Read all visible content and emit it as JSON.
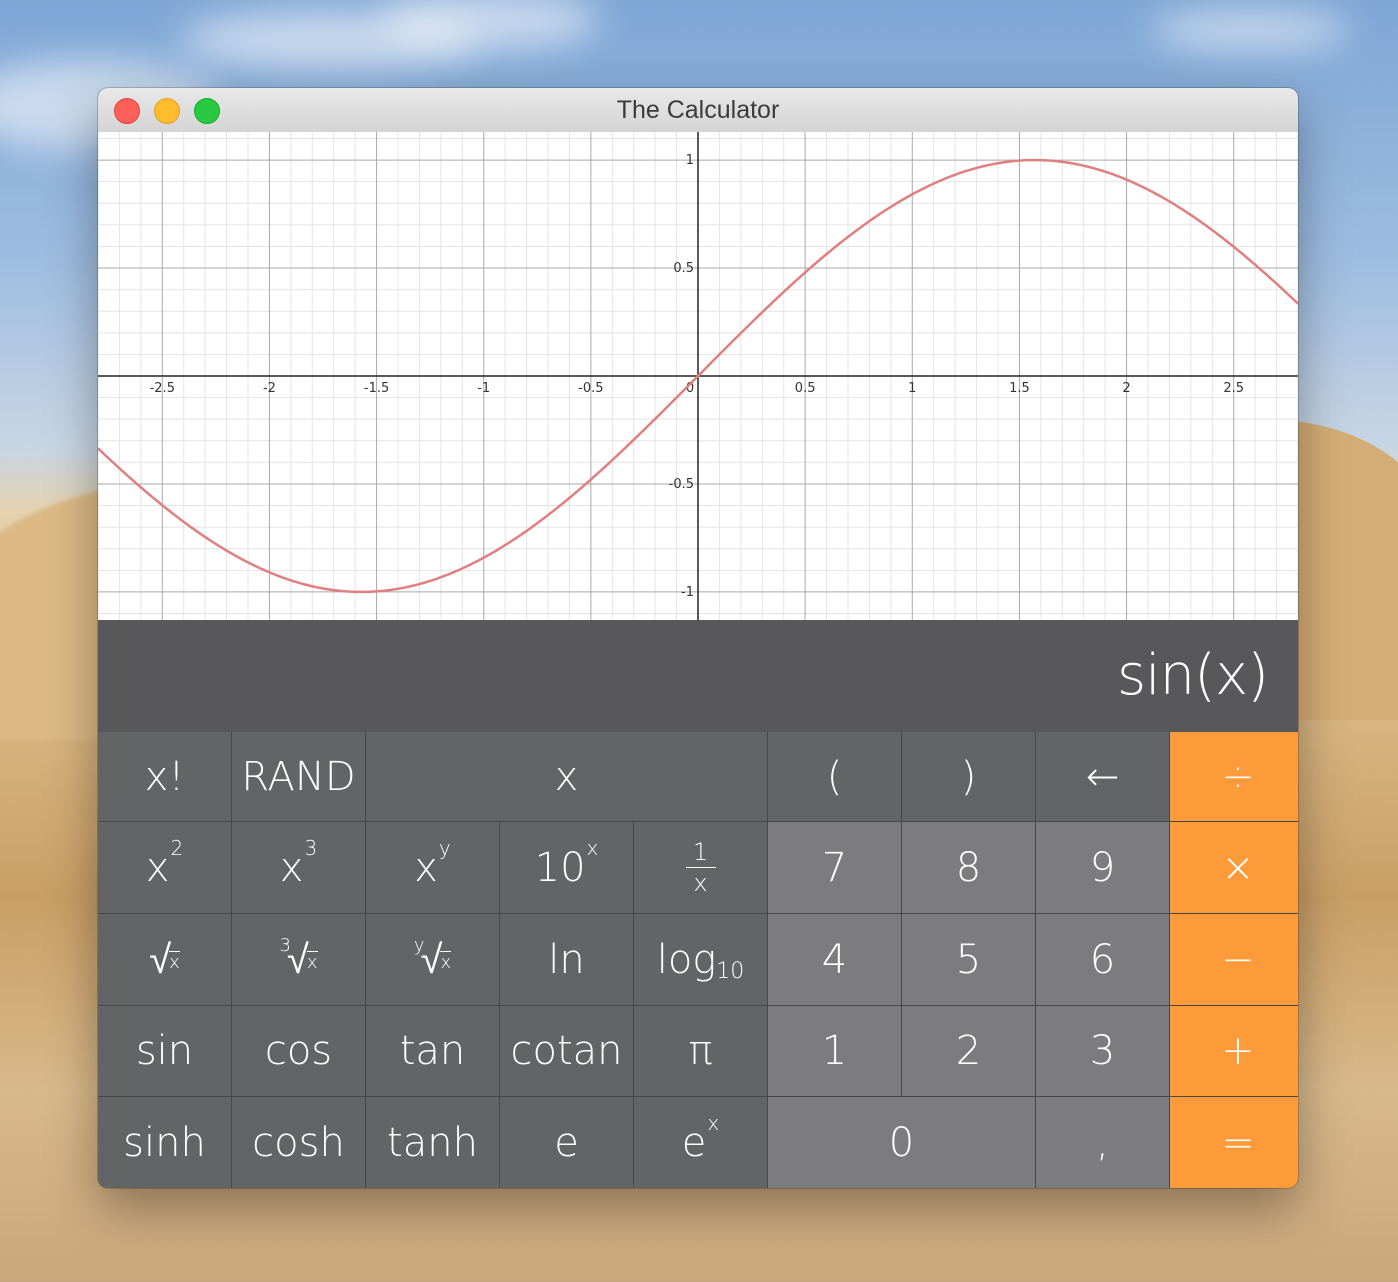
{
  "window": {
    "title": "The Calculator"
  },
  "chart_data": {
    "type": "line",
    "function": "sin(x)",
    "xlim": [
      -2.8,
      2.8
    ],
    "ylim": [
      -1.13,
      1.13
    ],
    "x_ticks": [
      "-2.5",
      "-2",
      "-1.5",
      "-1",
      "-0.5",
      "0",
      "0.5",
      "1",
      "1.5",
      "2",
      "2.5"
    ],
    "y_ticks": [
      "1",
      "0.5",
      "-0.5",
      "-1"
    ],
    "grid": true,
    "series": [
      {
        "color": "#e07f80",
        "x": [
          -2.8,
          -2.5,
          -2.0,
          -1.5708,
          -1.0,
          -0.5,
          0,
          0.5,
          1.0,
          1.5708,
          2.0,
          2.5,
          2.8
        ],
        "y": [
          -0.335,
          -0.598,
          -0.909,
          -1.0,
          -0.841,
          -0.479,
          0,
          0.479,
          0.841,
          1.0,
          0.909,
          0.598,
          0.335
        ]
      }
    ]
  },
  "display": {
    "expression": "sin(x)"
  },
  "keys": {
    "factorial": "x!",
    "rand": "RAND",
    "x": "x",
    "open_paren": "(",
    "close_paren": ")",
    "backspace": "←",
    "divide": "÷",
    "square_base": "x",
    "square_exp": "2",
    "cube_base": "x",
    "cube_exp": "3",
    "power_base": "x",
    "power_exp": "y",
    "ten_pow_base": "10",
    "ten_pow_exp": "x",
    "reciprocal_num": "1",
    "reciprocal_den": "x",
    "seven": "7",
    "eight": "8",
    "nine": "9",
    "multiply": "×",
    "sqrt_sym": "√",
    "sqrt_rad": "x",
    "cbrt_idx": "3",
    "cbrt_sym": "√",
    "cbrt_rad": "x",
    "yroot_idx": "y",
    "yroot_sym": "√",
    "yroot_rad": "x",
    "ln": "ln",
    "log_base": "log",
    "log_sub": "10",
    "four": "4",
    "five": "5",
    "six": "6",
    "minus": "−",
    "sin": "sin",
    "cos": "cos",
    "tan": "tan",
    "cotan": "cotan",
    "pi": "π",
    "one": "1",
    "two": "2",
    "three": "3",
    "plus": "+",
    "sinh": "sinh",
    "cosh": "cosh",
    "tanh": "tanh",
    "e": "e",
    "exp_base": "e",
    "exp_exp": "x",
    "zero": "0",
    "comma": ",",
    "equals": "="
  },
  "colors": {
    "function_bg": "#636466",
    "number_bg": "#7c7c7e",
    "operator_bg": "#fd9a3a",
    "display_bg": "#58585a",
    "curve": "#e07f80"
  }
}
